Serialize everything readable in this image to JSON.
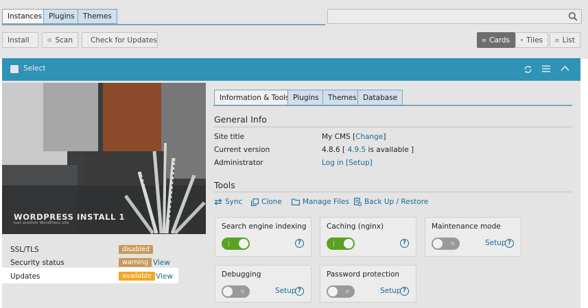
{
  "tabs": [
    "Instances",
    "Plugins",
    "Themes"
  ],
  "search": {
    "placeholder": ""
  },
  "toolbar": {
    "install": "Install",
    "scan": "Scan",
    "check_updates": "Check for Updates",
    "views": [
      "Cards",
      "Tiles",
      "List"
    ]
  },
  "header": {
    "select": "Select"
  },
  "instance": {
    "title": "WORDPRESS INSTALL 1",
    "subtitle": "Just another WordPress site"
  },
  "status": [
    {
      "label": "SSL/TLS",
      "badge": "disabled",
      "badge_color": "#c79a59",
      "link": ""
    },
    {
      "label": "Security status",
      "badge": "warning",
      "badge_color": "#c79a59",
      "link": "View"
    },
    {
      "label": "Updates",
      "badge": "available",
      "badge_color": "#f5a623",
      "link": "View"
    }
  ],
  "detail_tabs": [
    "Information & Tools",
    "Plugins",
    "Themes",
    "Database"
  ],
  "general": {
    "heading": "General Info",
    "site_title_label": "Site title",
    "site_title_value": "My CMS [",
    "site_title_link": "Change",
    "site_title_end": "]",
    "version_label": "Current version",
    "version_value": "4.8.6 [ ",
    "version_link": "4.9.5",
    "version_end": " is available ]",
    "admin_label": "Administrator",
    "admin_login": "Log in",
    "admin_setup": "[Setup]"
  },
  "tools": {
    "heading": "Tools",
    "items": [
      "Sync",
      "Clone",
      "Manage Files",
      "Back Up / Restore"
    ]
  },
  "cards": [
    {
      "title": "Search engine indexing",
      "state": "on",
      "action": ""
    },
    {
      "title": "Caching (nginx)",
      "state": "on",
      "action": ""
    },
    {
      "title": "Maintenance mode",
      "state": "off",
      "action": "Setup"
    },
    {
      "title": "Debugging",
      "state": "off",
      "action": "Setup"
    },
    {
      "title": "Password protection",
      "state": "off",
      "action": "Setup"
    }
  ],
  "colors": {
    "accent": "#2f93b5",
    "toggle_on": "#5aa222",
    "link": "#1a6a99"
  }
}
